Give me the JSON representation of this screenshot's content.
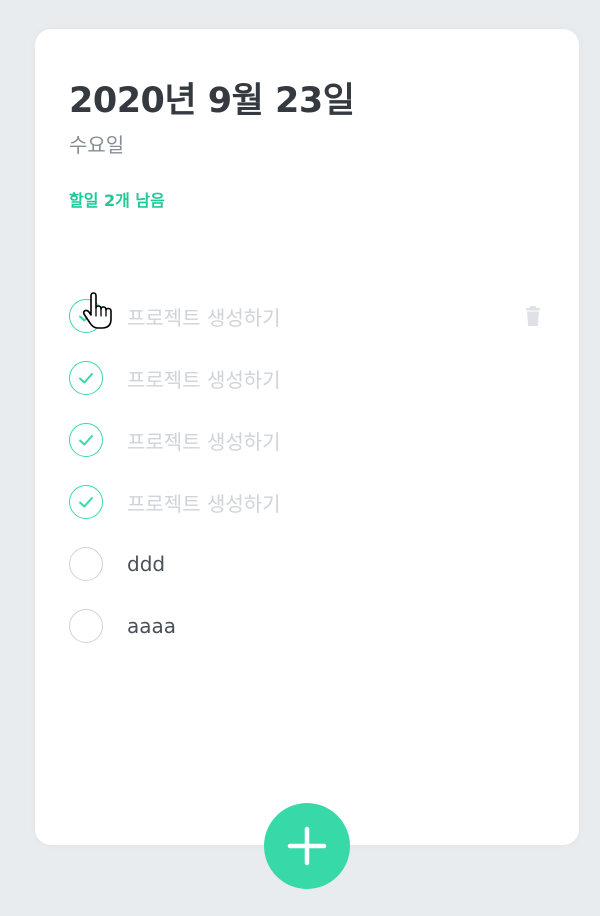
{
  "header": {
    "date": "2020년 9월 23일",
    "day": "수요일",
    "tasks_left": "할일 2개 남음"
  },
  "todos": [
    {
      "text": "프로젝트 생성하기",
      "done": true
    },
    {
      "text": "프로젝트 생성하기",
      "done": true
    },
    {
      "text": "프로젝트 생성하기",
      "done": true
    },
    {
      "text": "프로젝트 생성하기",
      "done": true
    },
    {
      "text": "ddd",
      "done": false
    },
    {
      "text": "aaaa",
      "done": false
    }
  ],
  "icons": {
    "check": "check-icon",
    "delete": "trash-icon",
    "add": "plus-icon",
    "cursor": "hand-pointer-icon"
  },
  "colors": {
    "accent": "#38d9a9",
    "accent_text": "#20c997",
    "done_text": "#ced4da",
    "text": "#495057",
    "title": "#343a40"
  }
}
